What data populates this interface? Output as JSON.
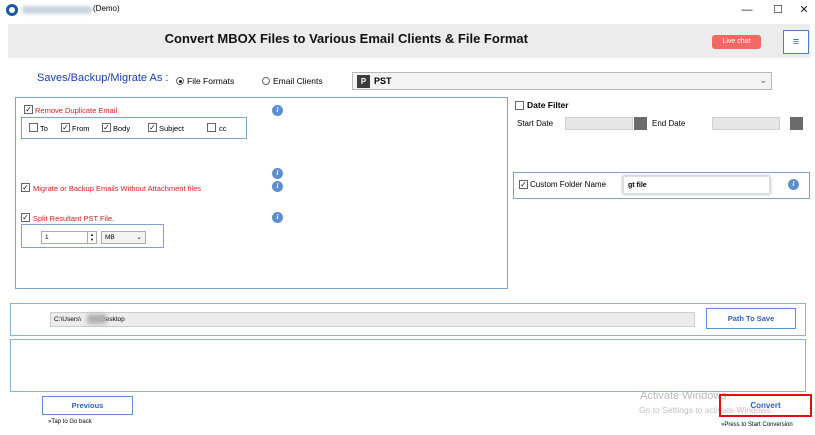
{
  "window": {
    "title": "(Demo)",
    "minimize": "—",
    "maximize": "☐",
    "close": "✕"
  },
  "header": {
    "title": "Convert MBOX Files to Various Email Clients & File Format",
    "live_chat": "Live chat",
    "menu_glyph": "≡"
  },
  "saves": {
    "label": "Saves/Backup/Migrate As :",
    "options": [
      {
        "label": "File Formats",
        "selected": true
      },
      {
        "label": "Email Clients",
        "selected": false
      }
    ],
    "format_icon": "P",
    "format_value": "PST",
    "arrow": "⌄"
  },
  "options": {
    "remove_duplicate": {
      "label": "Remove Duplicate Email",
      "checked": true
    },
    "fields": [
      {
        "label": "To",
        "checked": false
      },
      {
        "label": "From",
        "checked": true
      },
      {
        "label": "Body",
        "checked": true
      },
      {
        "label": "Subject",
        "checked": true
      },
      {
        "label": "cc",
        "checked": false
      }
    ],
    "migrate_without_attachment": {
      "label": "Migrate or Backup Emails Without Attachment files",
      "checked": true
    },
    "split_pst": {
      "label": "Split Resultant PST File.",
      "checked": true
    },
    "split_size": "1",
    "split_unit": "MB",
    "info_glyph": "i"
  },
  "date_filter": {
    "label": "Date Filter",
    "checked": false,
    "start_label": "Start Date",
    "end_label": "End Date"
  },
  "custom_folder": {
    "label": "Custom Folder Name",
    "checked": true,
    "value": "gt file"
  },
  "path": {
    "value_prefix": "C:\\Users\\",
    "value_suffix": "\\Desktop",
    "button": "Path To Save"
  },
  "footer": {
    "previous": "Previous",
    "previous_hint": "»Tap to Go back",
    "convert": "Convert",
    "convert_hint": "»Press to Start Conversion",
    "watermark_title": "Activate Windows",
    "watermark_sub": "Go to Settings to activate Windows."
  },
  "colors": {
    "accent_blue": "#2d63b8",
    "label_red": "#d02020",
    "live_chat": "#f06a63",
    "highlight_border": "#e01010"
  }
}
